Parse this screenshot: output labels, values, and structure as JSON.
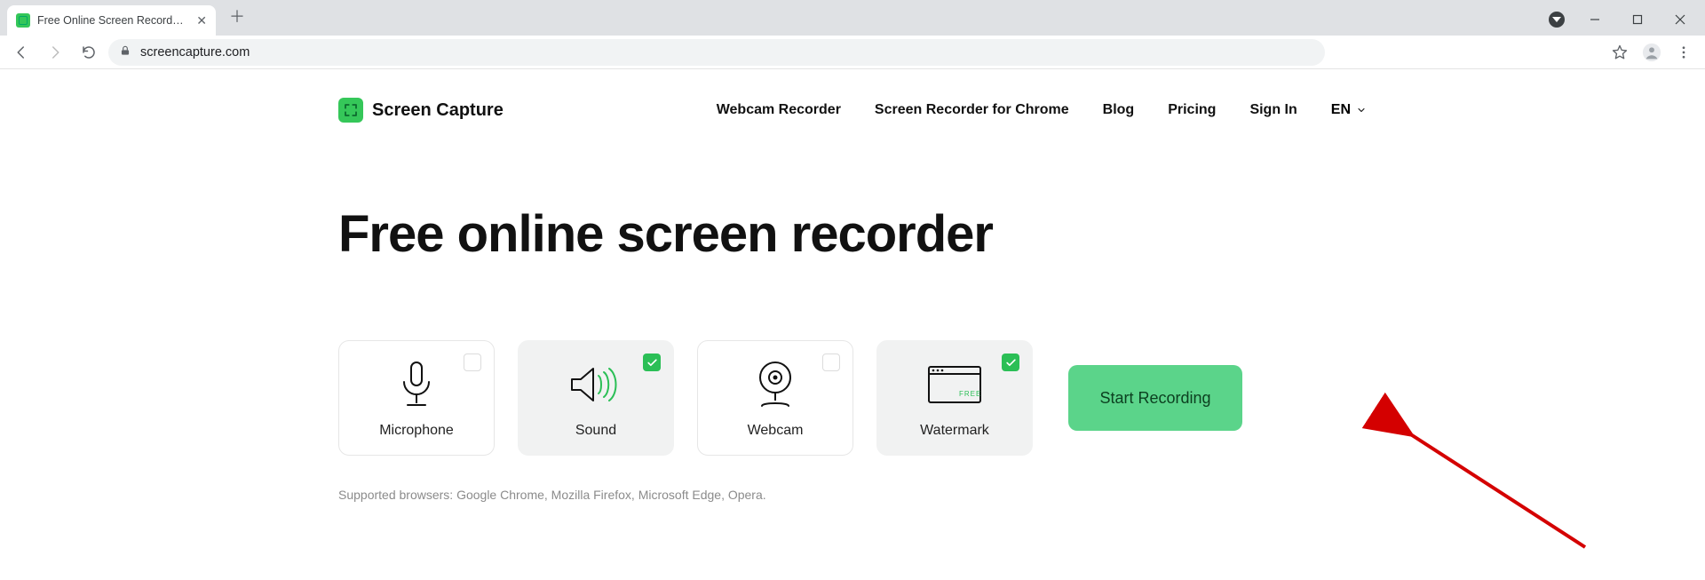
{
  "browser": {
    "tab_title": "Free Online Screen Recorder | Fre",
    "url": "screencapture.com"
  },
  "header": {
    "brand": "Screen Capture",
    "nav": {
      "webcam": "Webcam Recorder",
      "chrome": "Screen Recorder for Chrome",
      "blog": "Blog",
      "pricing": "Pricing",
      "signin": "Sign In",
      "lang": "EN"
    }
  },
  "hero": {
    "title": "Free online screen recorder"
  },
  "options": {
    "microphone": {
      "label": "Microphone",
      "checked": false
    },
    "sound": {
      "label": "Sound",
      "checked": true
    },
    "webcam": {
      "label": "Webcam",
      "checked": false
    },
    "watermark": {
      "label": "Watermark",
      "checked": true
    }
  },
  "cta": {
    "start": "Start Recording"
  },
  "supported": "Supported browsers: Google Chrome, Mozilla Firefox, Microsoft Edge, Opera."
}
